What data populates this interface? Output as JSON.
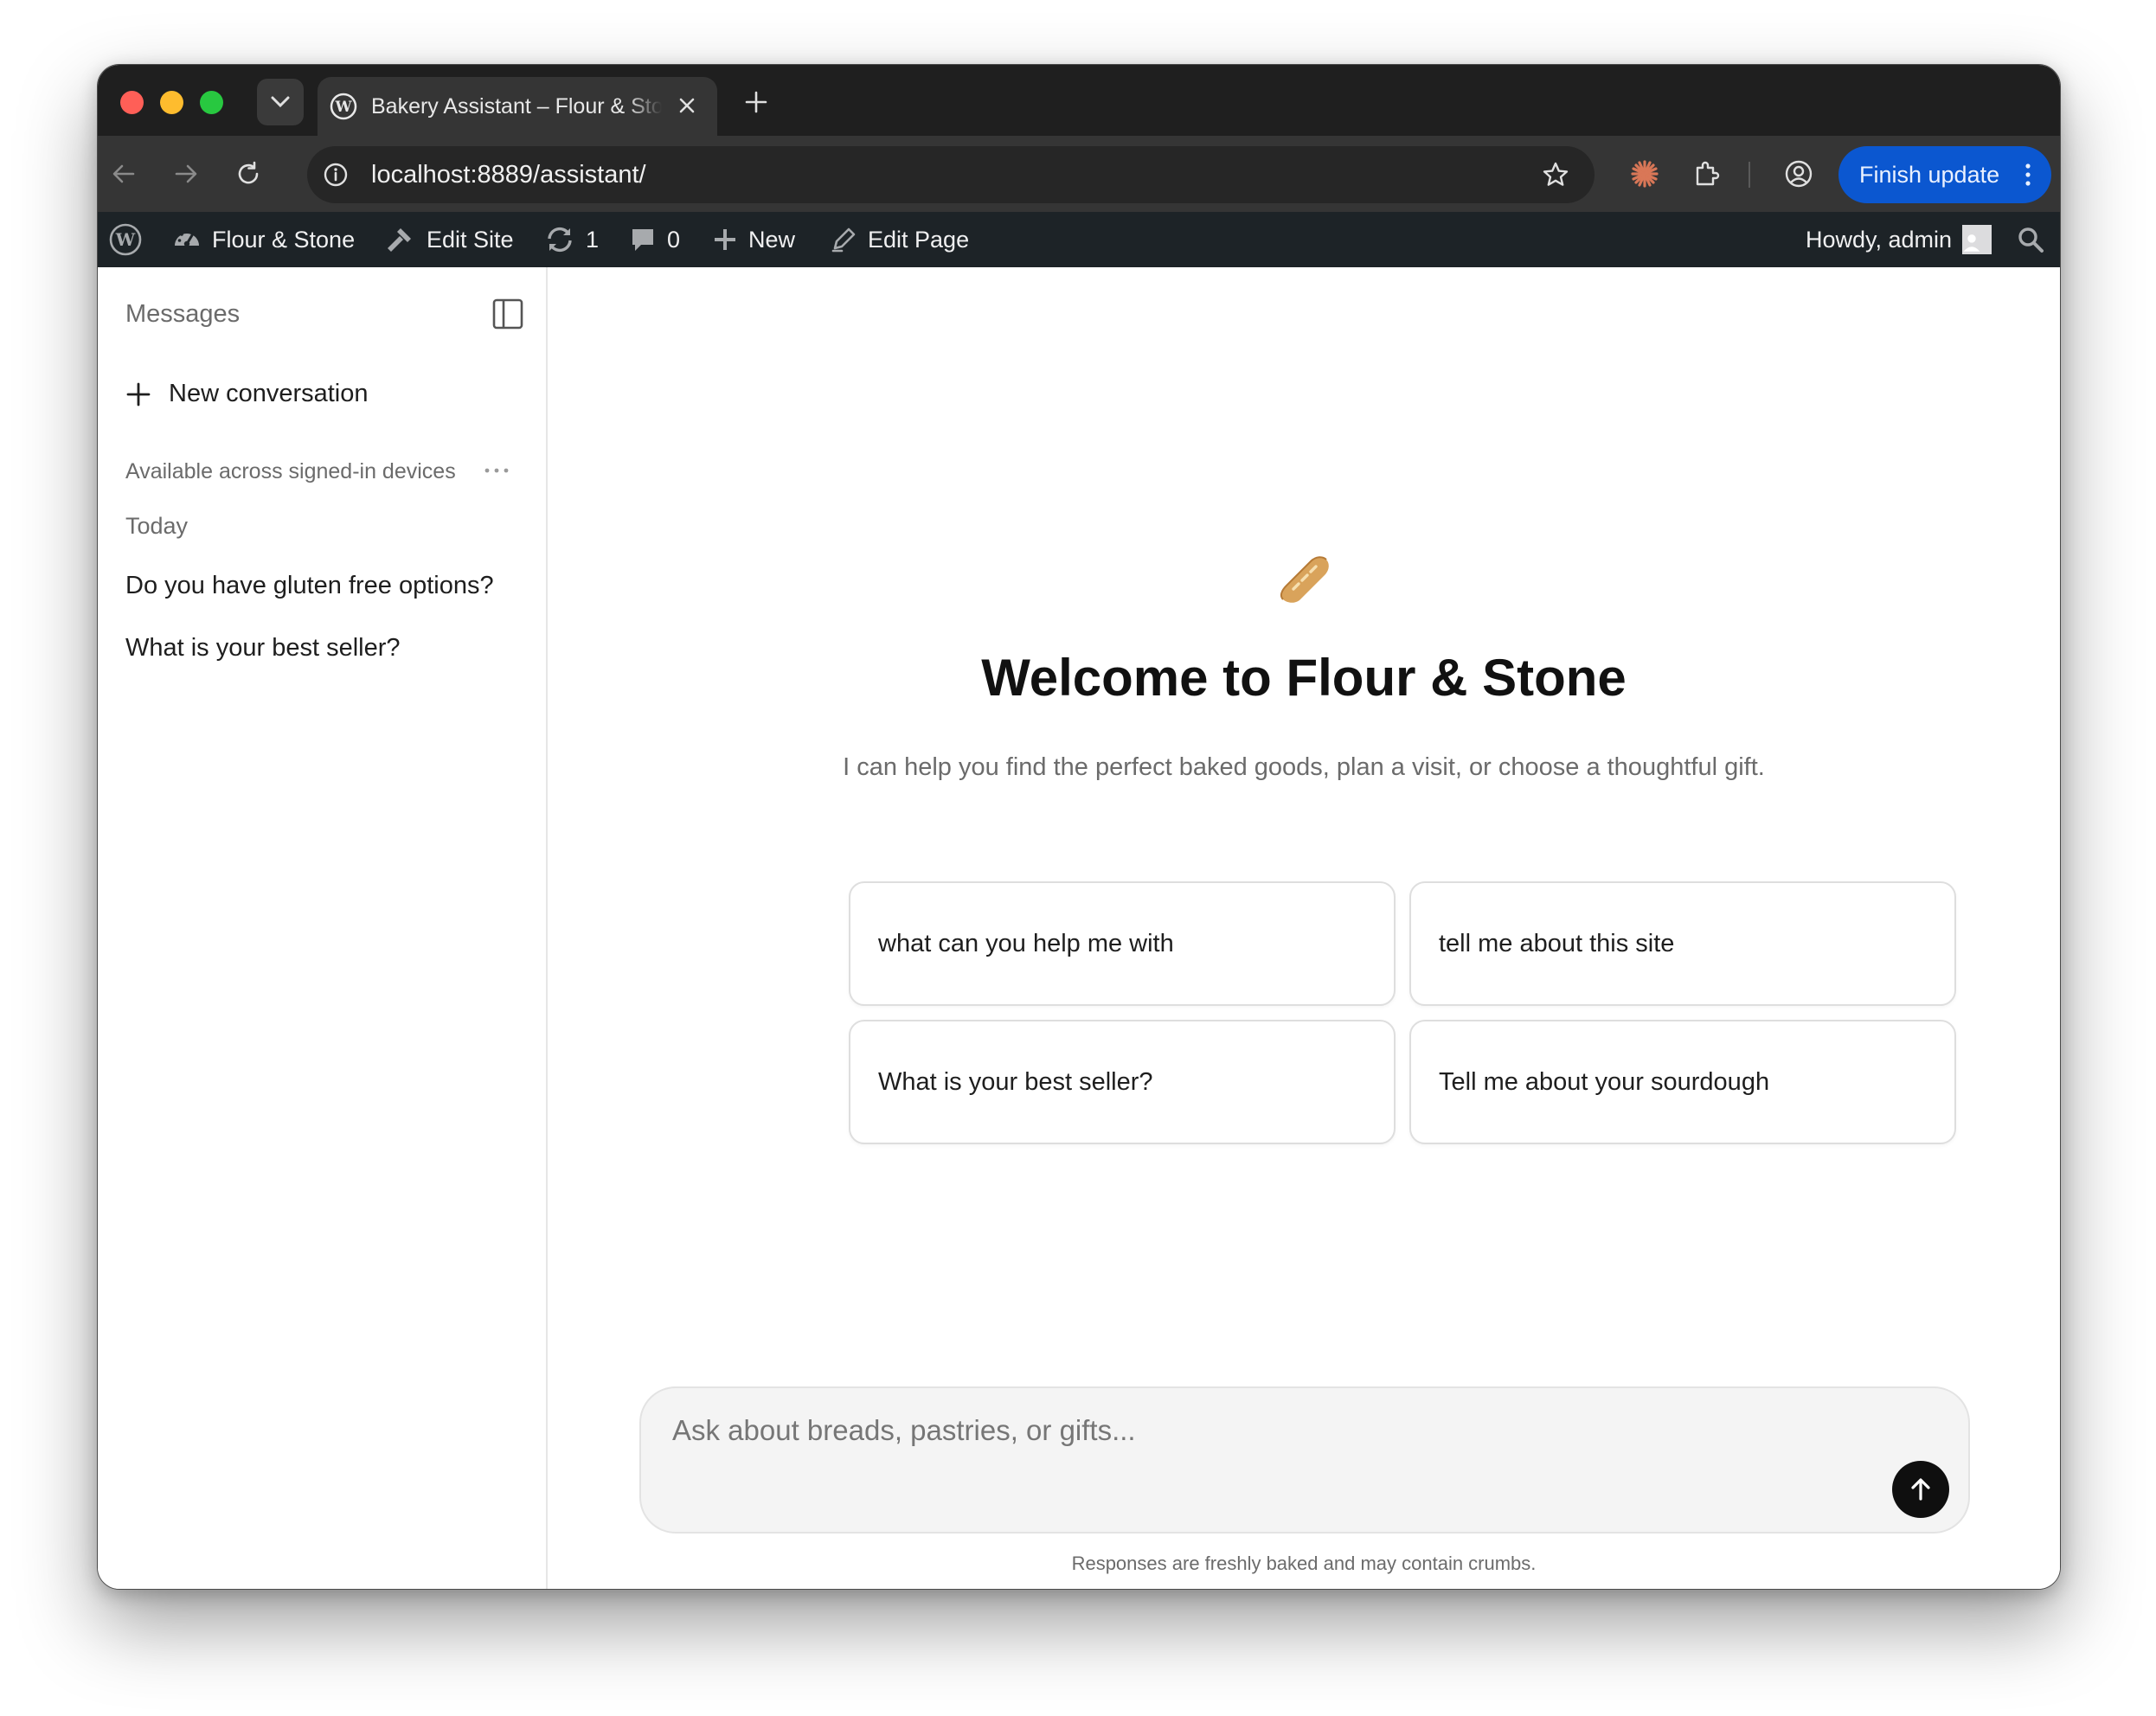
{
  "browser": {
    "tab_title": "Bakery Assistant – Flour & Stone",
    "url": "localhost:8889/assistant/",
    "finish_update_label": "Finish update",
    "accent_color": "#0b57d0"
  },
  "adminbar": {
    "site_name": "Flour & Stone",
    "edit_site": "Edit Site",
    "updates_count": "1",
    "comments_count": "0",
    "new_label": "New",
    "edit_page": "Edit Page",
    "howdy": "Howdy, admin"
  },
  "sidebar": {
    "title": "Messages",
    "new_conversation": "New conversation",
    "sync_note": "Available across signed-in devices",
    "group_label": "Today",
    "conversations": [
      "Do you have gluten free options?",
      "What is your best seller?"
    ]
  },
  "main": {
    "hero_icon": "baguette-icon",
    "title": "Welcome to Flour & Stone",
    "subtitle": "I can help you find the perfect baked goods, plan a visit, or choose a thoughtful gift.",
    "suggestions": [
      "what can you help me with",
      "tell me about this site",
      "What is your best seller?",
      "Tell me about your sourdough"
    ],
    "composer_placeholder": "Ask about breads, pastries, or gifts...",
    "disclaimer": "Responses are freshly baked and may contain crumbs."
  }
}
